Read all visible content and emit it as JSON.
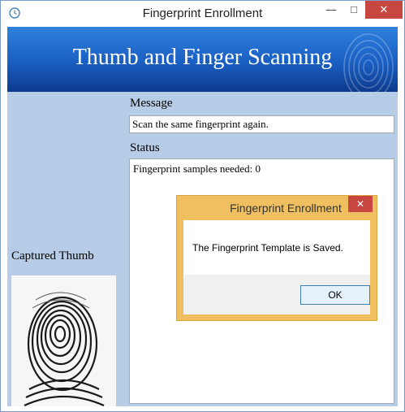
{
  "window": {
    "title": "Fingerprint Enrollment",
    "minimize": "—",
    "maximize": "□",
    "close": "✕"
  },
  "banner": {
    "title": "Thumb and Finger Scanning"
  },
  "message": {
    "label": "Message",
    "value": "Scan the same fingerprint again."
  },
  "status": {
    "label": "Status",
    "text": "Fingerprint samples needed: 0"
  },
  "thumb": {
    "label": "Captured Thumb"
  },
  "dialog": {
    "title": "Fingerprint Enrollment",
    "close": "✕",
    "message": "The Fingerprint Template is Saved.",
    "ok_label": "OK"
  },
  "colors": {
    "banner": "#1a5fc2",
    "client": "#b7cce7",
    "dialog_frame": "#f0c060",
    "close_button": "#c7463f"
  },
  "icons": [
    "app-clock-icon",
    "fingerprint-watermark-icon",
    "captured-fingerprint-image"
  ]
}
